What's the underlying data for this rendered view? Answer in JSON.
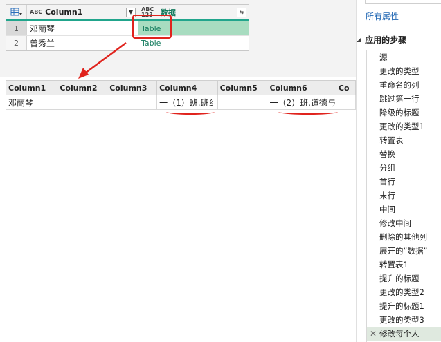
{
  "query_table": {
    "col1_type": "ABC",
    "col1_header": "Column1",
    "col2_type": "ABC 123",
    "col2_header": "数据",
    "rows": [
      {
        "num": "1",
        "name": "邓丽琴",
        "value": "Table"
      },
      {
        "num": "2",
        "name": "曾秀兰",
        "value": "Table"
      }
    ]
  },
  "preview_table": {
    "headers": [
      "Column1",
      "Column2",
      "Column3",
      "Column4",
      "Column5",
      "Column6",
      "Co"
    ],
    "row": [
      "邓丽琴",
      "",
      "",
      "一（1）班.班纟",
      "",
      "一（2）班.道德与",
      ""
    ]
  },
  "sidebar": {
    "all_properties": "所有属性",
    "section_title": "应用的步骤",
    "steps": [
      "源",
      "更改的类型",
      "重命名的列",
      "跳过第一行",
      "降级的标题",
      "更改的类型1",
      "转置表",
      "替换",
      "分组",
      "首行",
      "末行",
      "中间",
      "修改中间",
      "删除的其他列",
      "展开的“数据”",
      "转置表1",
      "提升的标题",
      "更改的类型2",
      "提升的标题1",
      "更改的类型3",
      "修改每个人"
    ],
    "selected_step": "修改每个人"
  },
  "colors": {
    "accent": "#21a58c",
    "annotation": "#e0231d",
    "link": "#1f66b3"
  }
}
